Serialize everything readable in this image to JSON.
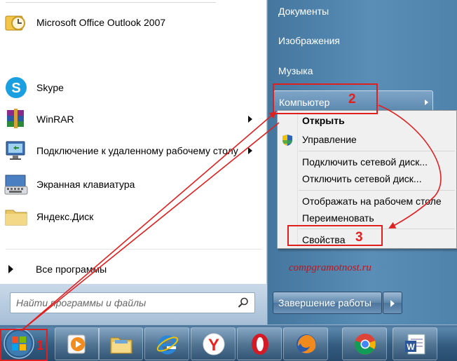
{
  "start_menu": {
    "programs": [
      {
        "label": "Microsoft Office Outlook 2007",
        "icon": "outlook-icon",
        "has_submenu": false
      },
      {
        "label": "Skype",
        "icon": "skype-icon",
        "has_submenu": false
      },
      {
        "label": "WinRAR",
        "icon": "winrar-icon",
        "has_submenu": true
      },
      {
        "label": "Подключение к удаленному рабочему столу",
        "icon": "remote-desktop-icon",
        "has_submenu": true
      },
      {
        "label": "Экранная клавиатура",
        "icon": "keyboard-icon",
        "has_submenu": false
      },
      {
        "label": "Яндекс.Диск",
        "icon": "folder-icon",
        "has_submenu": false
      }
    ],
    "all_programs": "Все программы",
    "search_placeholder": "Найти программы и файлы",
    "right_items": [
      "Документы",
      "Изображения",
      "Музыка",
      "Компьютер"
    ],
    "shutdown": "Завершение работы"
  },
  "context_menu": {
    "items": [
      {
        "label": "Открыть",
        "bold": true
      },
      {
        "label": "Управление",
        "icon": "shield-icon"
      },
      {
        "label": "Подключить сетевой диск..."
      },
      {
        "label": "Отключить сетевой диск..."
      },
      {
        "label": "Отображать на рабочем столе"
      },
      {
        "label": "Переименовать"
      },
      {
        "label": "Свойства"
      }
    ]
  },
  "annotations": {
    "step1": "1",
    "step2": "2",
    "step3": "3",
    "watermark": "compgramotnost.ru"
  },
  "taskbar": {
    "pinned": [
      "start-orb-icon",
      "media-player-icon",
      "explorer-folder-icon",
      "ie-icon",
      "yandex-browser-icon",
      "opera-icon",
      "firefox-icon",
      "chrome-icon",
      "word-icon"
    ]
  },
  "colors": {
    "annotation_red": "#e02020",
    "right_pane_blue": "#4f83ac",
    "taskbar_blue": "#335c80"
  }
}
